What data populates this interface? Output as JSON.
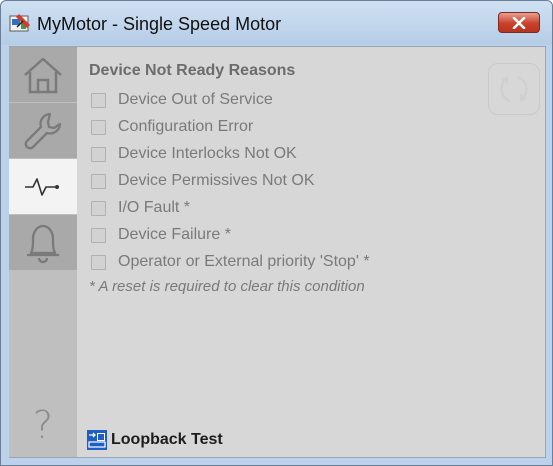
{
  "window": {
    "title": "MyMotor - Single Speed Motor"
  },
  "sidebar": {
    "items": [
      {
        "icon": "home-icon"
      },
      {
        "icon": "wrench-icon"
      },
      {
        "icon": "pulse-icon"
      },
      {
        "icon": "bell-icon"
      }
    ],
    "help_label": "?"
  },
  "panel": {
    "title": "Device Not Ready Reasons",
    "reasons": [
      "Device Out of Service",
      "Configuration Error",
      "Device Interlocks Not OK",
      "Device Permissives Not OK",
      "I/O Fault *",
      "Device Failure *",
      "Operator or External priority 'Stop' *"
    ],
    "note": "* A reset is required to clear this condition"
  },
  "footer": {
    "loopback_label": "Loopback Test"
  },
  "colors": {
    "title_bar": "#bcd2ea",
    "close_button": "#c8422b",
    "panel_background": "#d7d7d7",
    "sidebar_background": "#a9a9a9",
    "active_tab": "#f3f3f3"
  }
}
